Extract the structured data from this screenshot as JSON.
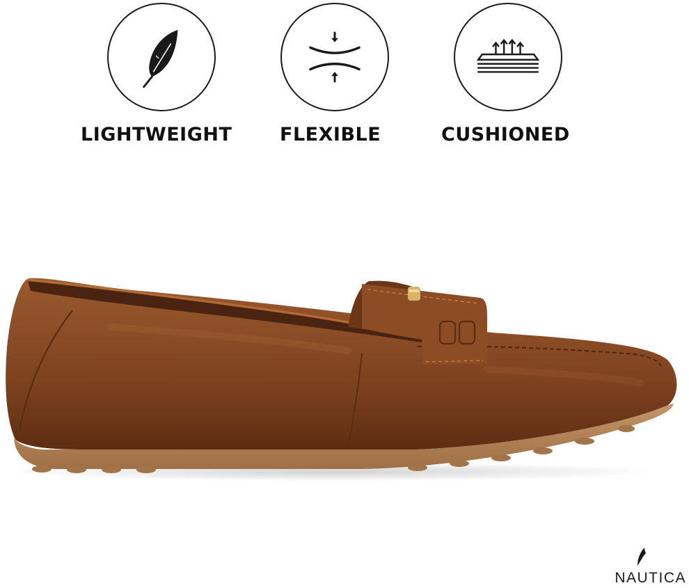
{
  "features": [
    {
      "icon": "feather-icon",
      "label": "LIGHTWEIGHT"
    },
    {
      "icon": "flex-arrows-icon",
      "label": "FLEXIBLE"
    },
    {
      "icon": "cushion-layers-icon",
      "label": "CUSHIONED"
    }
  ],
  "brand": {
    "name": "NAUTICA",
    "icon": "sail-icon"
  },
  "product": {
    "description": "brown leather loafer side view",
    "colors": {
      "upper": "#8a4a22",
      "upper_shade": "#6a3418",
      "sole": "#b9865a",
      "stitch": "#c07a3a",
      "hardware": "#d9b36a"
    }
  }
}
